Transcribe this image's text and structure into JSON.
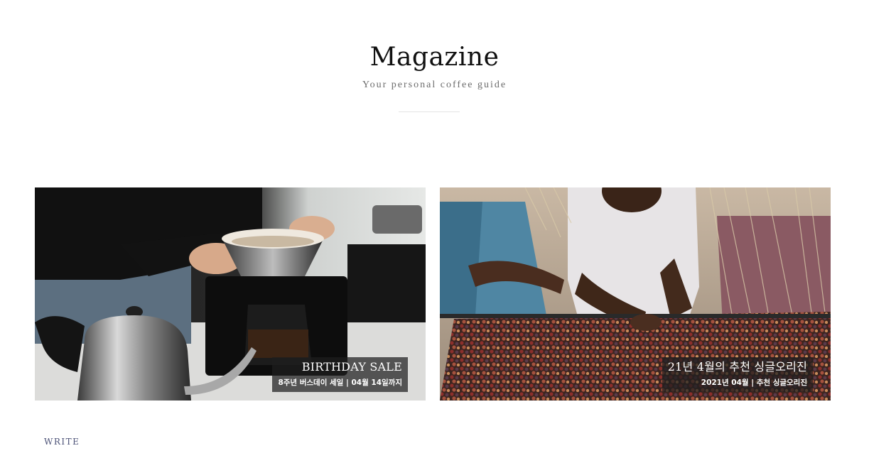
{
  "header": {
    "title": "Magazine",
    "subtitle": "Your personal coffee guide"
  },
  "cards": [
    {
      "title": "BIRTHDAY SALE",
      "subtitle": "8주년 버스데이 세일 | 04월 14일까지",
      "image": "pour-over-coffee-brewing"
    },
    {
      "title": "21년 4월의 추천 싱글오리진",
      "subtitle": "2021년 04월 | 추천 싱글오리진",
      "image": "coffee-cherry-sorting"
    }
  ],
  "footer": {
    "write_label": "WRITE"
  },
  "colors": {
    "accent_link": "#4d5378",
    "caption_bg": "#1e1e1e",
    "divider": "#e4e4e4"
  }
}
